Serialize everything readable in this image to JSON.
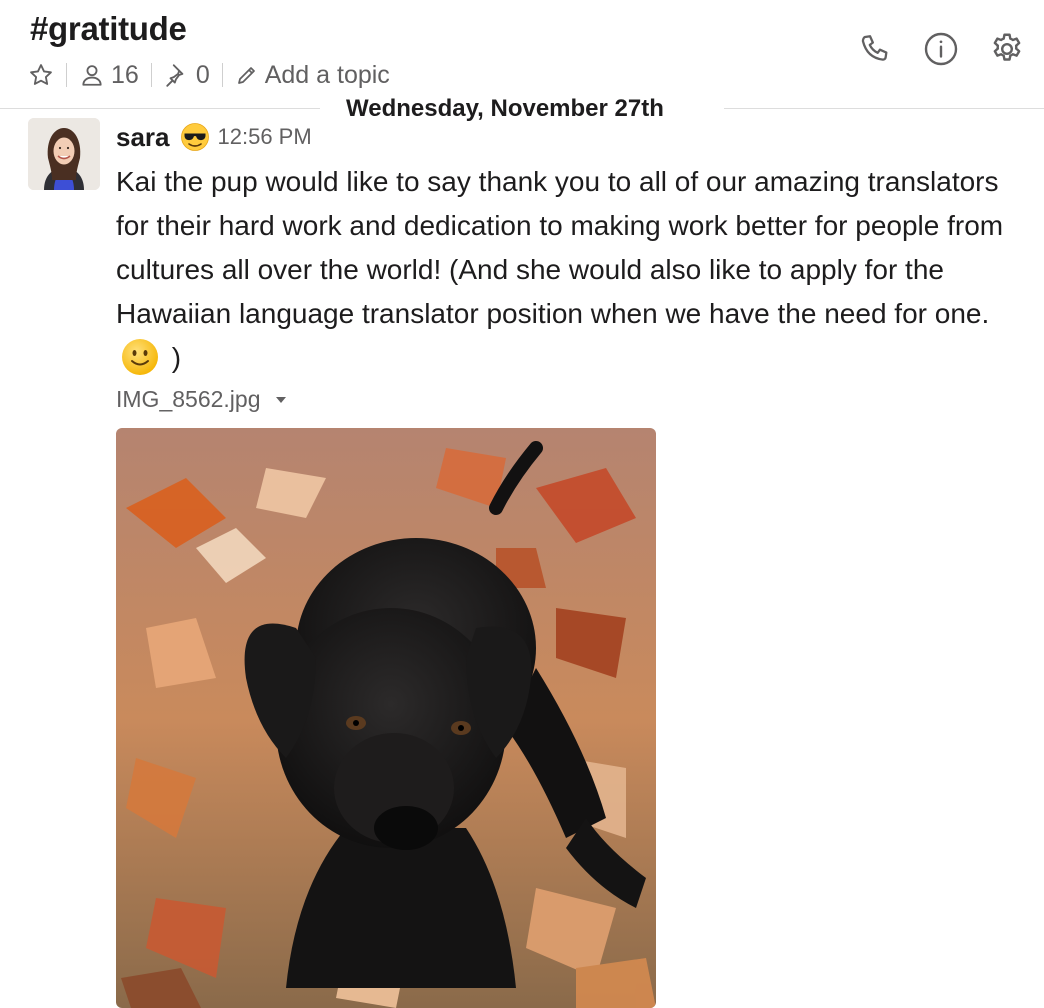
{
  "channel": {
    "name": "#gratitude",
    "member_count": "16",
    "pinned_count": "0",
    "topic_placeholder": "Add a topic"
  },
  "header_actions": {
    "icons": [
      "phone-icon",
      "info-icon",
      "gear-icon"
    ]
  },
  "divider": {
    "date": "Wednesday, November 27th"
  },
  "message": {
    "sender": "sara",
    "status_emoji": "sunglasses",
    "time": "12:56 PM",
    "text_part1": "Kai the pup would like to say thank you to all of our amazing translators for their hard work and dedication to making work better for people from cultures all over the world! (And she would also like to apply for the Hawaiian language translator position when we have the need for one.",
    "inline_emoji": "slightly-smiling-face",
    "text_part2": ")",
    "attachment": {
      "file_name": "IMG_8562.jpg"
    }
  },
  "colors": {
    "text": "#1d1c1d",
    "muted": "#616061",
    "divider": "#dddddd"
  }
}
